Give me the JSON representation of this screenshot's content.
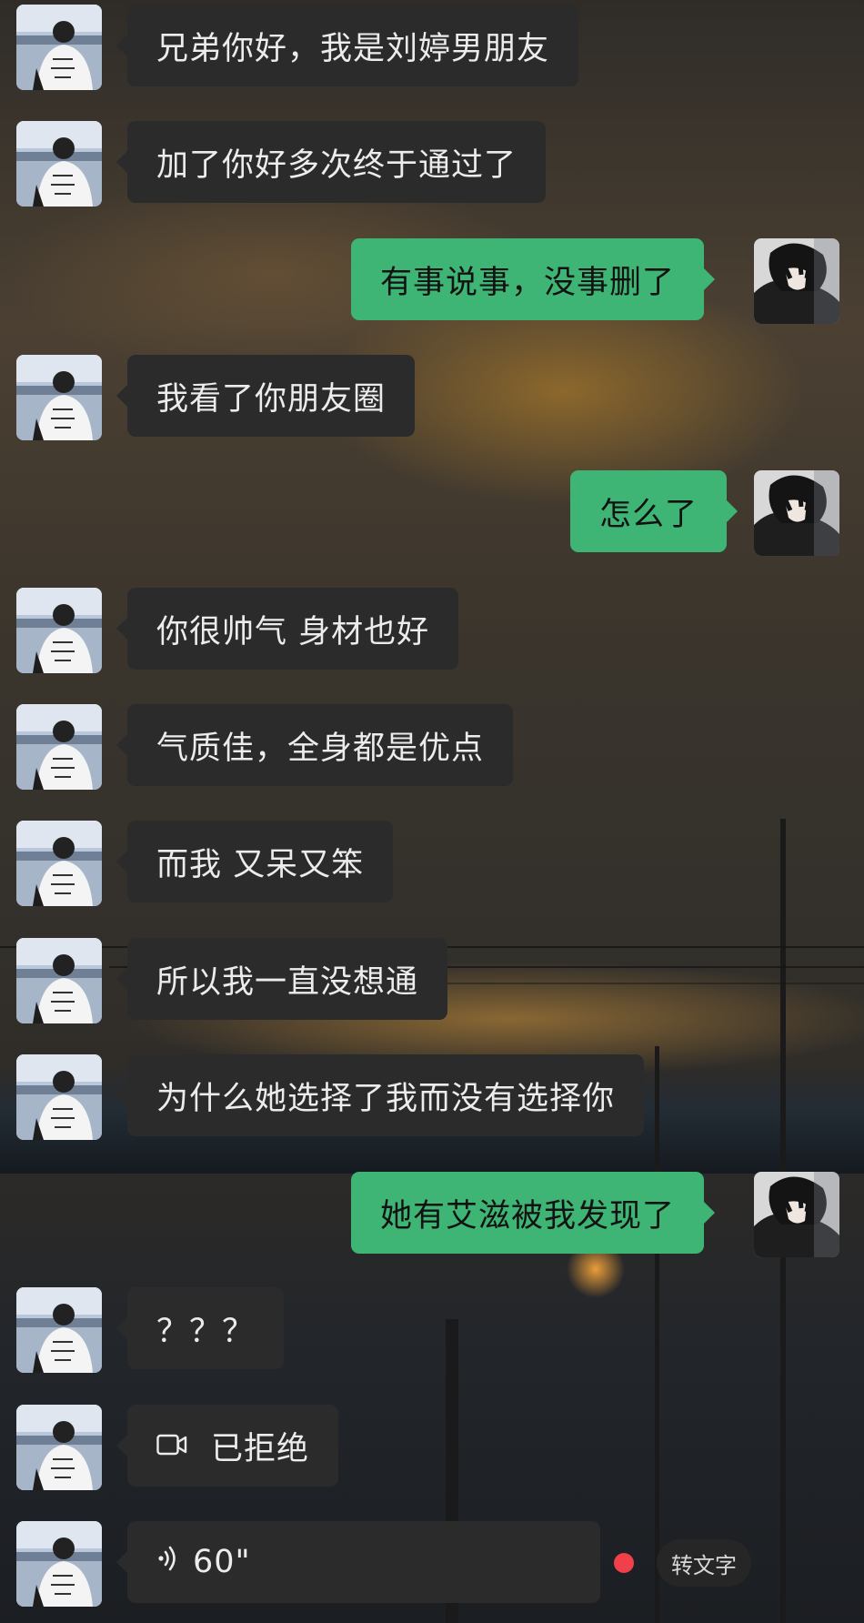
{
  "colors": {
    "incoming_bubble": "#2b2b2b",
    "outgoing_bubble": "#3eb575",
    "unread_dot": "#f2404a"
  },
  "messages": [
    {
      "side": "in",
      "text": "兄弟你好，我是刘婷男朋友"
    },
    {
      "side": "in",
      "text": "加了你好多次终于通过了"
    },
    {
      "side": "out",
      "text": "有事说事，没事删了"
    },
    {
      "side": "in",
      "text": "我看了你朋友圈"
    },
    {
      "side": "out",
      "text": "怎么了"
    },
    {
      "side": "in",
      "text": "你很帅气  身材也好"
    },
    {
      "side": "in",
      "text": "气质佳，全身都是优点"
    },
    {
      "side": "in",
      "text": "而我 又呆又笨"
    },
    {
      "side": "in",
      "text": "所以我一直没想通"
    },
    {
      "side": "in",
      "text": "为什么她选择了我而没有选择你"
    },
    {
      "side": "out",
      "text": "她有艾滋被我发现了"
    },
    {
      "side": "in",
      "text": "？？？"
    },
    {
      "side": "in",
      "kind": "video_call",
      "icon": "video-camera-icon",
      "text": "已拒绝"
    },
    {
      "side": "in",
      "kind": "voice",
      "icon": "voice-wave-icon",
      "text": "60\"",
      "unread": true,
      "transcribe_label": "转文字"
    }
  ]
}
